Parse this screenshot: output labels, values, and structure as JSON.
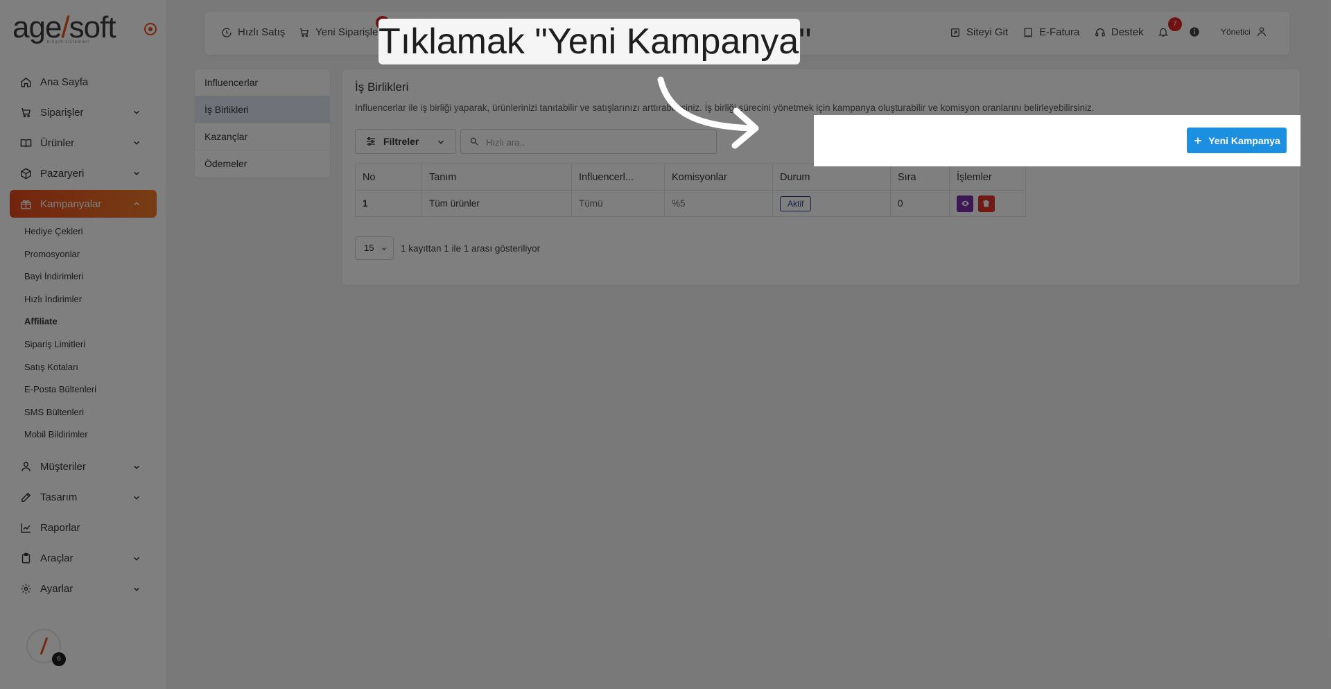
{
  "brand": {
    "logo_main": "age",
    "logo_tail": "soft",
    "logo_sub": "bilişim sistemleri"
  },
  "sidebar": {
    "items": [
      {
        "label": "Ana Sayfa",
        "icon": "home-icon",
        "has_chevron": false
      },
      {
        "label": "Siparişler",
        "icon": "cart-icon",
        "has_chevron": true
      },
      {
        "label": "Ürünler",
        "icon": "book-icon",
        "has_chevron": true
      },
      {
        "label": "Pazaryeri",
        "icon": "box-icon",
        "has_chevron": true
      },
      {
        "label": "Kampanyalar",
        "icon": "gift-icon",
        "has_chevron": true,
        "active": true
      }
    ],
    "sub_items": [
      "Hediye Çekleri",
      "Promosyonlar",
      "Bayi İndirimleri",
      "Hızlı İndirimler",
      "Affiliate",
      "Sipariş Limitleri",
      "Satış Kotaları",
      "E-Posta Bültenleri",
      "SMS Bültenleri",
      "Mobil Bildirimler"
    ],
    "active_sub": "Affiliate",
    "bottom_items": [
      {
        "label": "Müşteriler",
        "icon": "user-icon",
        "has_chevron": true
      },
      {
        "label": "Tasarım",
        "icon": "edit-icon",
        "has_chevron": true
      },
      {
        "label": "Raporlar",
        "icon": "chart-icon",
        "has_chevron": false
      },
      {
        "label": "Araçlar",
        "icon": "clipboard-icon",
        "has_chevron": true
      },
      {
        "label": "Ayarlar",
        "icon": "gear-icon",
        "has_chevron": true
      }
    ],
    "badge_count": "6"
  },
  "topbar": {
    "quick_sale": "Hızlı Satış",
    "new_orders": "Yeni Siparişler",
    "site": "Siteyi Git",
    "einvoice": "E-Fatura",
    "support": "Destek",
    "notif_count": "7",
    "user": "Yönetici"
  },
  "submenu": {
    "items": [
      "Influencerlar",
      "İş Birlikleri",
      "Kazançlar",
      "Ödemeler"
    ],
    "active": "İş Birlikleri"
  },
  "main": {
    "title": "İş Birlikleri",
    "description": "Influencerlar ile iş birliği yaparak, ürünlerinizi tanıtabilir ve satışlarınızı arttırabilirsiniz. İş birliği sürecini yönetmek için kampanya oluşturabilir ve komisyon oranlarını belirleyebilirsiniz.",
    "filter_label": "Filtreler",
    "search_placeholder": "Hızlı ara..",
    "new_button": "Yeni Kampanya",
    "table": {
      "headers": [
        "No",
        "Tanım",
        "Influencerl...",
        "Komisyonlar",
        "Durum",
        "Sıra",
        "İşlemler"
      ],
      "rows": [
        {
          "no": "1",
          "name": "Tüm ürünler",
          "influencers": "Tümü",
          "commission": "%5",
          "status": "Aktif",
          "order": "0"
        }
      ]
    },
    "per_page": "15",
    "pager_text": "1 kayıttan 1 ile 1 arası gösteriliyor"
  },
  "callout": {
    "text": "Tıklamak \"Yeni Kampanya\""
  },
  "colors": {
    "accent": "#e8531f",
    "primary_button": "#1d8fe1",
    "view_button": "#7b2fa8",
    "delete_button": "#e0332b"
  }
}
